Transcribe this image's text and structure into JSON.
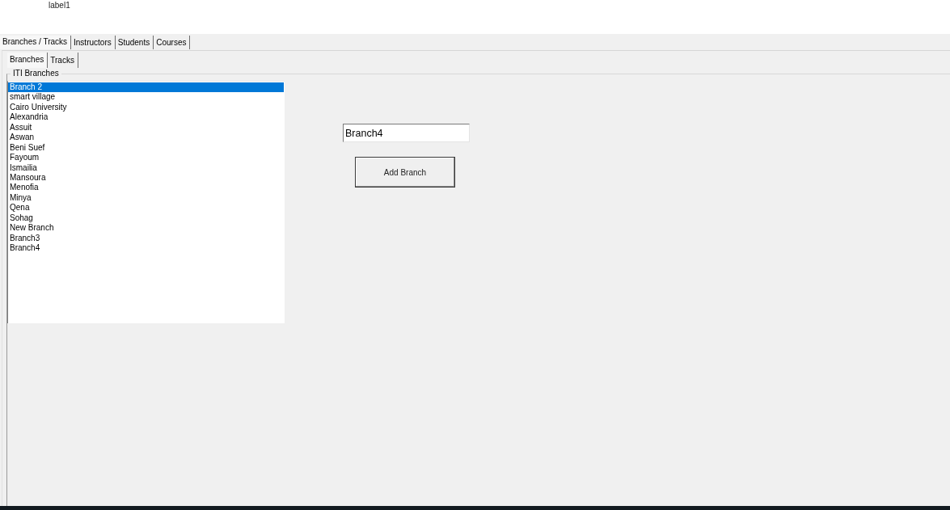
{
  "label": "label1",
  "tabs": [
    {
      "label": "Branches / Tracks",
      "selected": true
    },
    {
      "label": "Instructors",
      "selected": false
    },
    {
      "label": "Students",
      "selected": false
    },
    {
      "label": "Courses",
      "selected": false
    }
  ],
  "subtabs": [
    {
      "label": "Branches",
      "selected": true
    },
    {
      "label": "Tracks",
      "selected": false
    }
  ],
  "branches_group": {
    "title": "ITI Branches",
    "list": [
      {
        "label": "Branch 2",
        "selected": true
      },
      {
        "label": "smart village",
        "selected": false
      },
      {
        "label": "Cairo University",
        "selected": false
      },
      {
        "label": "Alexandria",
        "selected": false
      },
      {
        "label": "Assuit",
        "selected": false
      },
      {
        "label": "Aswan",
        "selected": false
      },
      {
        "label": "Beni Suef",
        "selected": false
      },
      {
        "label": "Fayoum",
        "selected": false
      },
      {
        "label": "Ismailia",
        "selected": false
      },
      {
        "label": "Mansoura",
        "selected": false
      },
      {
        "label": "Menofia",
        "selected": false
      },
      {
        "label": "Minya",
        "selected": false
      },
      {
        "label": "Qena",
        "selected": false
      },
      {
        "label": "Sohag",
        "selected": false
      },
      {
        "label": "New Branch",
        "selected": false
      },
      {
        "label": "Branch3",
        "selected": false
      },
      {
        "label": "Branch4",
        "selected": false
      }
    ],
    "name_field": {
      "value": "Branch4"
    },
    "add_button": {
      "label": "Add Branch"
    }
  }
}
